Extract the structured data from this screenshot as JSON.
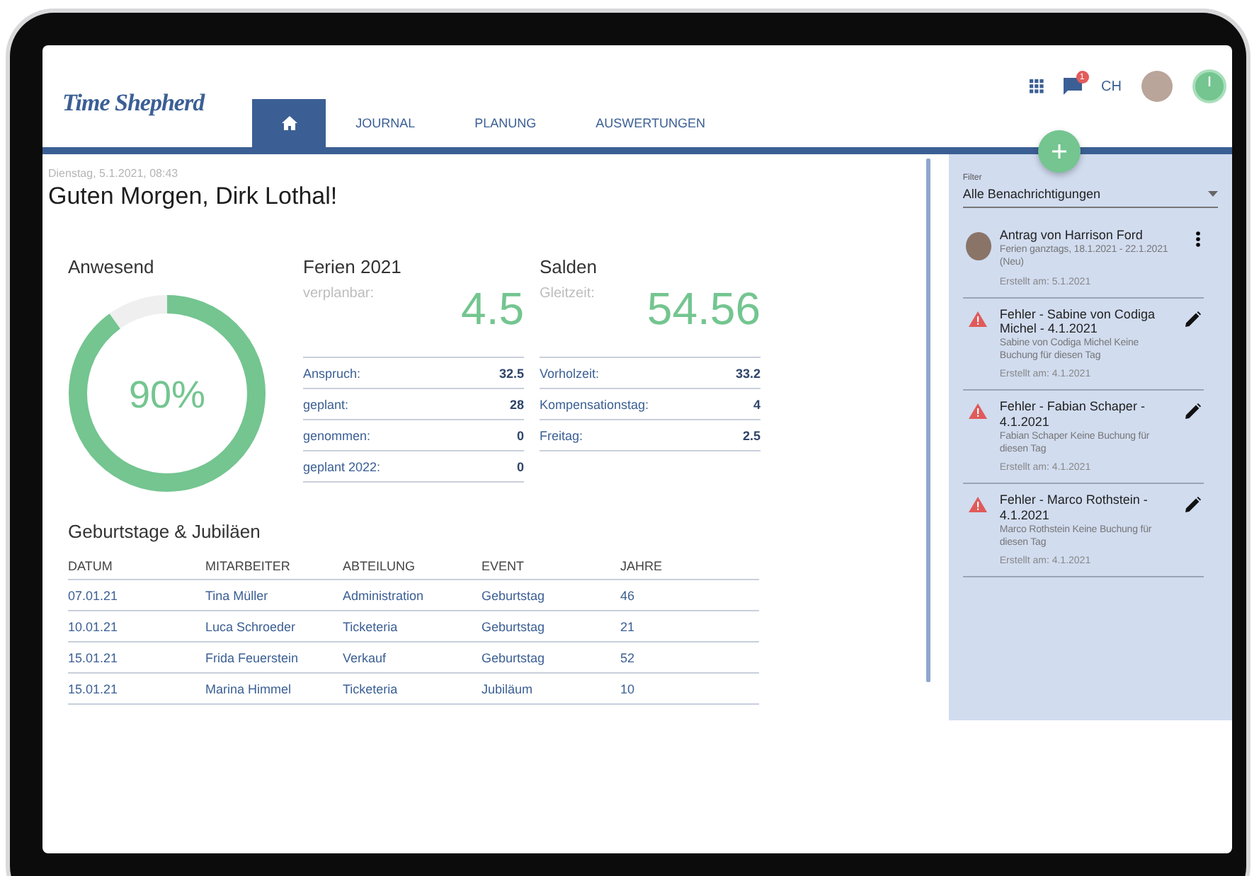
{
  "header": {
    "logo": "Time Shepherd",
    "tabs": [
      {
        "kind": "icon",
        "selected": true
      },
      {
        "kind": "text",
        "label": "JOURNAL",
        "selected": false
      },
      {
        "kind": "text",
        "label": "PLANUNG",
        "selected": false
      },
      {
        "kind": "text",
        "label": "AUSWERTUNGEN",
        "selected": false
      }
    ],
    "notification_count": "1",
    "user_initials": "CH"
  },
  "greeting": {
    "date": "Dienstag, 5.1.2021, 08:43",
    "title": "Guten Morgen, Dirk Lothal!"
  },
  "presence": {
    "title": "Anwesend",
    "level": 0.9,
    "value": "90%"
  },
  "vacation": {
    "title": "Ferien 2021",
    "highlight_label": "verplanbar:",
    "highlight_value": "4.5",
    "rows": [
      {
        "label": "Anspruch:",
        "value": "32.5"
      },
      {
        "label": "geplant:",
        "value": "28"
      },
      {
        "label": "genommen:",
        "value": "0"
      },
      {
        "label": "geplant 2022:",
        "value": "0"
      }
    ]
  },
  "balances": {
    "title": "Salden",
    "highlight_label": "Gleitzeit:",
    "highlight_value": "54.56",
    "rows": [
      {
        "label": "Vorholzeit:",
        "value": "33.2"
      },
      {
        "label": "Kompensationstag:",
        "value": "4"
      },
      {
        "label": "Freitag:",
        "value": "2.5"
      }
    ]
  },
  "events": {
    "title": "Geburtstage & Jubiläen",
    "columns": [
      "DATUM",
      "MITARBEITER",
      "ABTEILUNG",
      "EVENT",
      "JAHRE"
    ],
    "rows": [
      [
        "07.01.21",
        "Tina Müller",
        "Administration",
        "Geburtstag",
        "46"
      ],
      [
        "10.01.21",
        "Luca Schroeder",
        "Ticketeria",
        "Geburtstag",
        "21"
      ],
      [
        "15.01.21",
        "Frida Feuerstein",
        "Verkauf",
        "Geburtstag",
        "52"
      ],
      [
        "15.01.21",
        "Marina Himmel",
        "Ticketeria",
        "Jubiläum",
        "10"
      ]
    ]
  },
  "notifications": {
    "filter_label": "Filter",
    "filter_value": "Alle Benachrichtigungen",
    "items": [
      {
        "kind": "request",
        "title": "Antrag von Harrison Ford",
        "detail": "Ferien ganztags, 18.1.2021 - 22.1.2021 (Neu)",
        "created": "Erstellt am: 5.1.2021"
      },
      {
        "kind": "error",
        "title": "Fehler - Sabine von Codiga Michel - 4.1.2021",
        "detail": "Sabine von Codiga Michel Keine Buchung für diesen Tag",
        "created": "Erstellt am: 4.1.2021"
      },
      {
        "kind": "error",
        "title": "Fehler - Fabian Schaper - 4.1.2021",
        "detail": "Fabian Schaper Keine Buchung für diesen Tag",
        "created": "Erstellt am: 4.1.2021"
      },
      {
        "kind": "error",
        "title": "Fehler - Marco Rothstein - 4.1.2021",
        "detail": "Marco Rothstein Keine Buchung für diesen Tag",
        "created": "Erstellt am: 4.1.2021"
      }
    ]
  }
}
